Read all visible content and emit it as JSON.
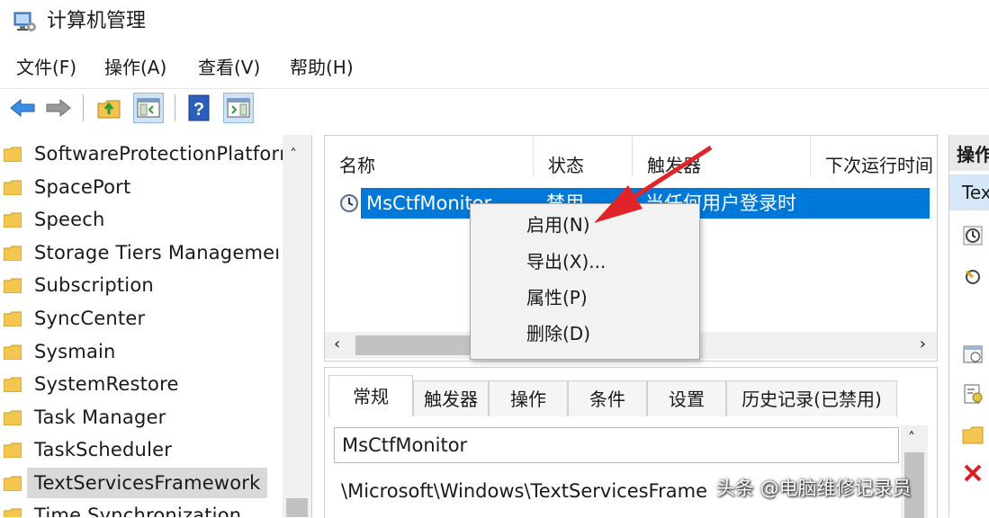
{
  "window": {
    "title": "计算机管理"
  },
  "menu": [
    "文件(F)",
    "操作(A)",
    "查看(V)",
    "帮助(H)"
  ],
  "toolbar": {
    "buttons": [
      "back-arrow-icon",
      "forward-arrow-icon",
      "up-folder-icon",
      "show-hide-tree-icon",
      "help-icon",
      "show-hide-action-pane-icon"
    ]
  },
  "tree": {
    "items": [
      "SoftwareProtectionPlatforı",
      "SpacePort",
      "Speech",
      "Storage Tiers Managemeı",
      "Subscription",
      "SyncCenter",
      "Sysmain",
      "SystemRestore",
      "Task Manager",
      "TaskScheduler",
      "TextServicesFramework",
      "Time Synchronization"
    ],
    "selected_index": 10
  },
  "task_list": {
    "columns": [
      "名称",
      "状态",
      "触发器",
      "下次运行时间"
    ],
    "selected_row": {
      "name": "MsCtfMonitor",
      "status": "禁用",
      "trigger": "当任何用户登录时"
    }
  },
  "context_menu": {
    "items": [
      "启用(N)",
      "导出(X)...",
      "属性(P)",
      "删除(D)"
    ]
  },
  "properties": {
    "tabs": [
      "常规",
      "触发器",
      "操作",
      "条件",
      "设置",
      "历史记录(已禁用)"
    ],
    "active_tab": 0,
    "name_value": "MsCtfMonitor",
    "location_value": "\\Microsoft\\Windows\\TextServicesFrame"
  },
  "actions_pane": {
    "header": "操作",
    "subheader": "TextServicesFramework"
  },
  "watermark": "头条 @电脑维修记录员",
  "colors": {
    "selection": "#0078d7",
    "arrow": "#e0242a"
  }
}
